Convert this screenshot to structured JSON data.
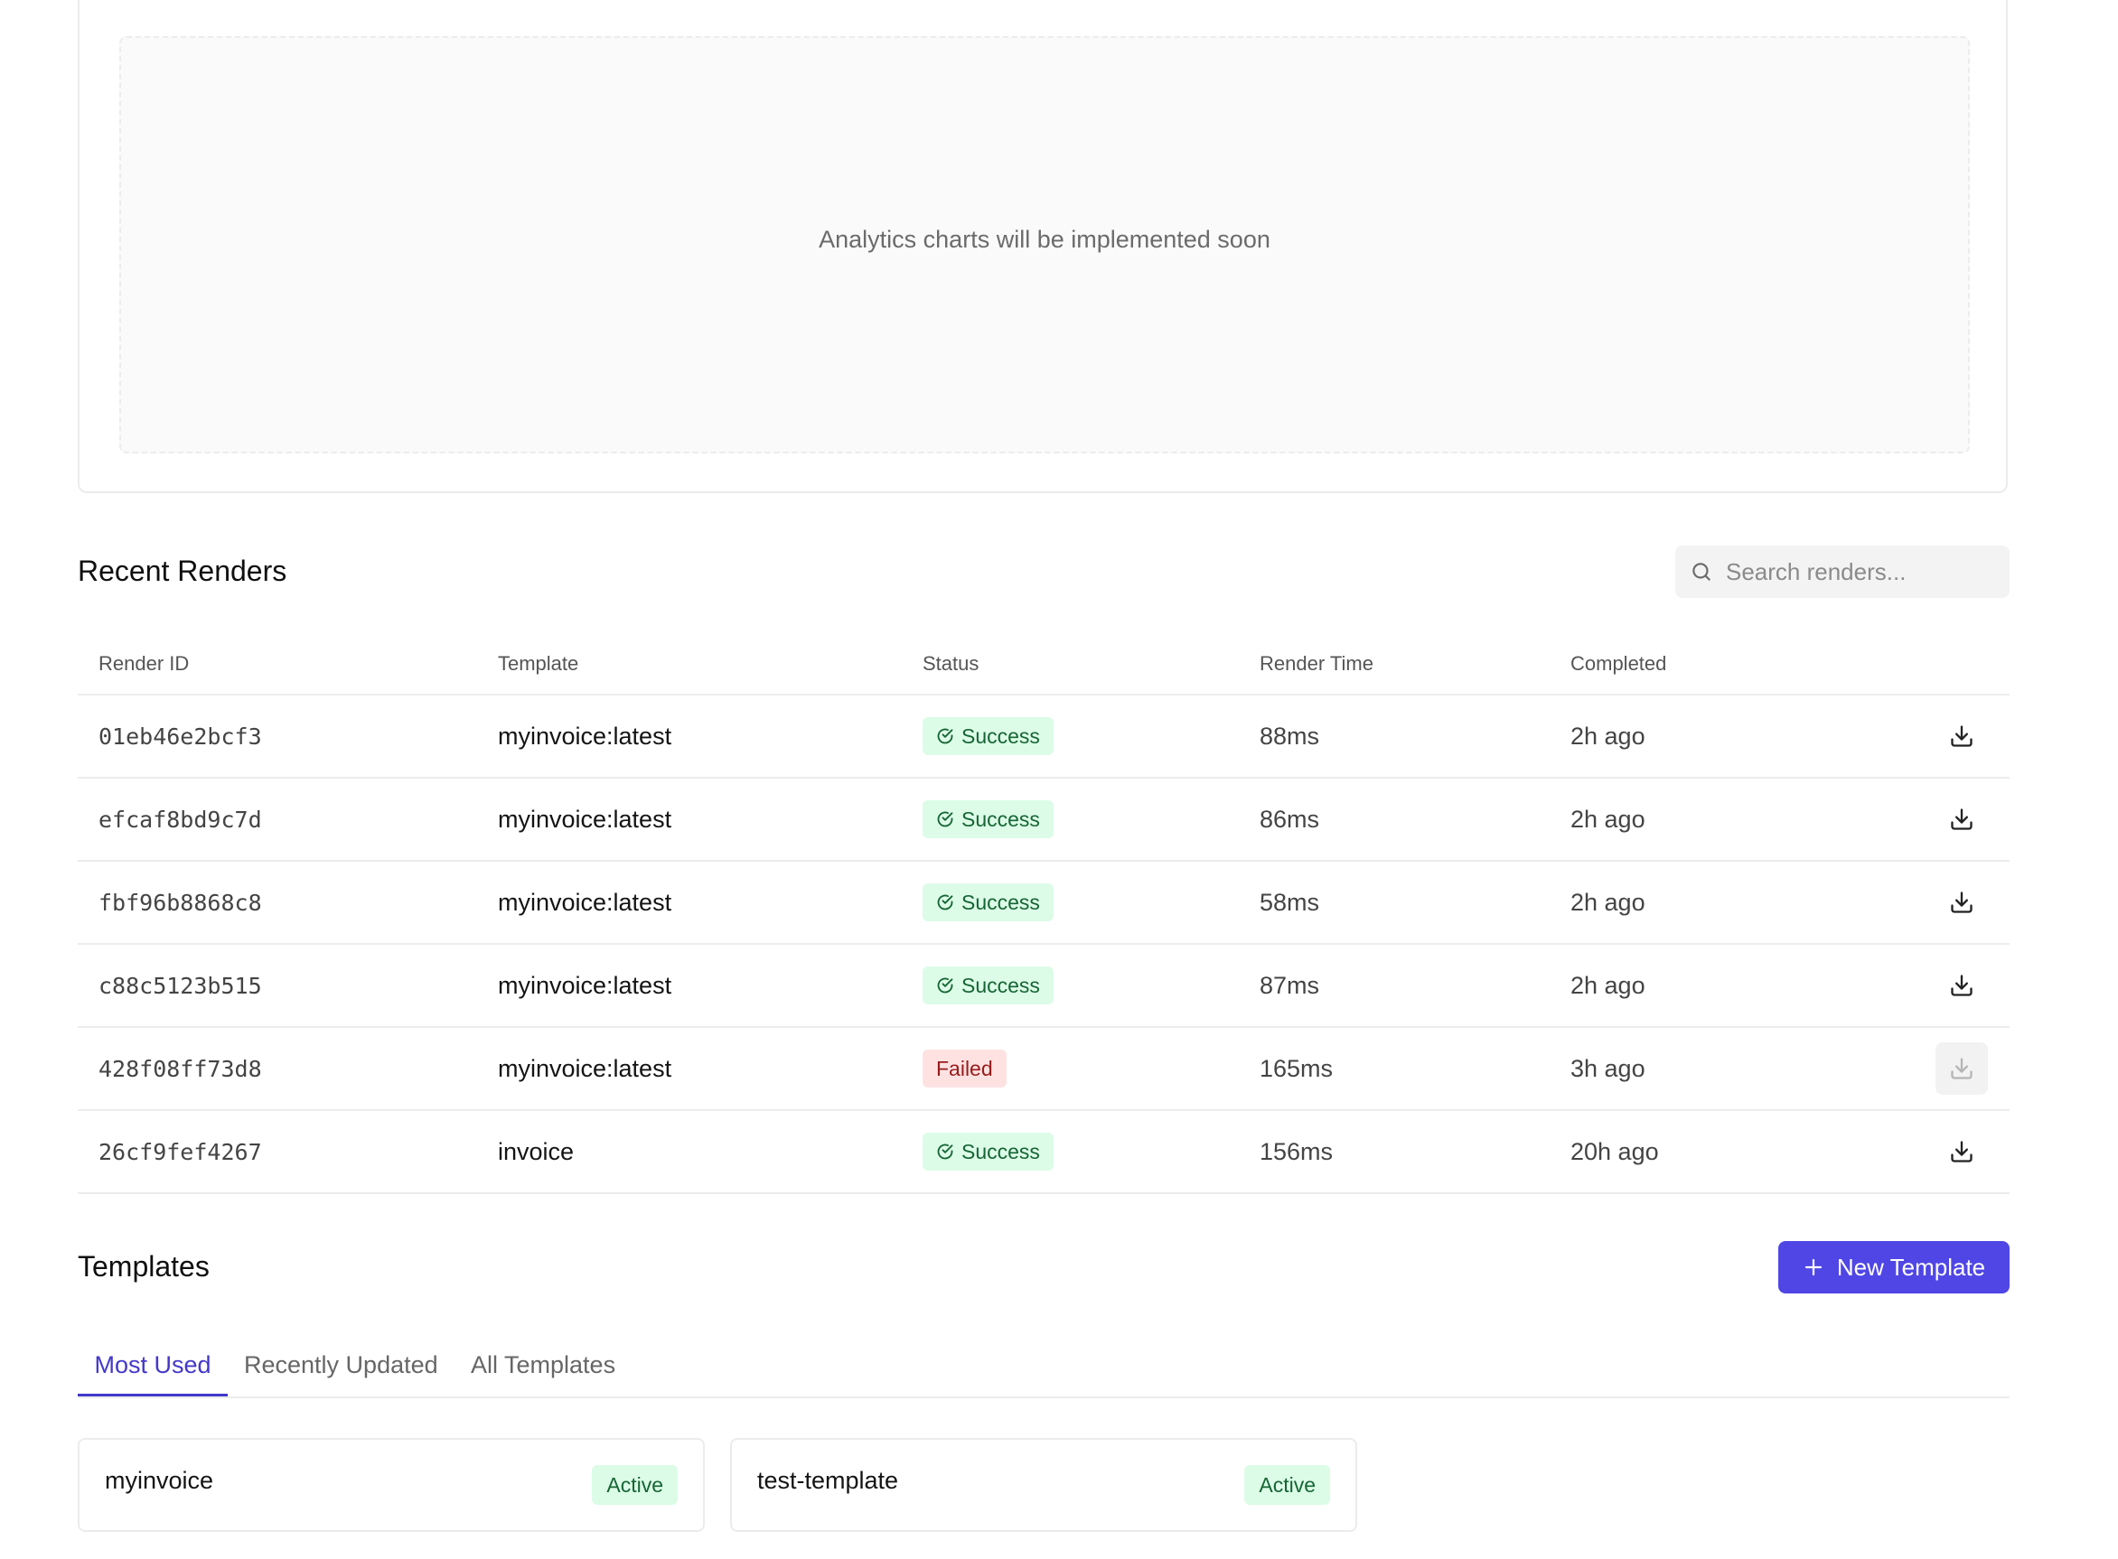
{
  "analytics": {
    "placeholder_text": "Analytics charts will be implemented soon"
  },
  "recent_renders": {
    "title": "Recent Renders",
    "search_placeholder": "Search renders...",
    "columns": {
      "render_id": "Render ID",
      "template": "Template",
      "status": "Status",
      "render_time": "Render Time",
      "completed": "Completed"
    },
    "rows": [
      {
        "id": "01eb46e2bcf3",
        "template": "myinvoice:latest",
        "status": "Success",
        "render_time": "88ms",
        "completed": "2h ago",
        "download_enabled": true
      },
      {
        "id": "efcaf8bd9c7d",
        "template": "myinvoice:latest",
        "status": "Success",
        "render_time": "86ms",
        "completed": "2h ago",
        "download_enabled": true
      },
      {
        "id": "fbf96b8868c8",
        "template": "myinvoice:latest",
        "status": "Success",
        "render_time": "58ms",
        "completed": "2h ago",
        "download_enabled": true
      },
      {
        "id": "c88c5123b515",
        "template": "myinvoice:latest",
        "status": "Success",
        "render_time": "87ms",
        "completed": "2h ago",
        "download_enabled": true
      },
      {
        "id": "428f08ff73d8",
        "template": "myinvoice:latest",
        "status": "Failed",
        "render_time": "165ms",
        "completed": "3h ago",
        "download_enabled": false
      },
      {
        "id": "26cf9fef4267",
        "template": "invoice",
        "status": "Success",
        "render_time": "156ms",
        "completed": "20h ago",
        "download_enabled": true
      }
    ]
  },
  "templates": {
    "title": "Templates",
    "new_button_label": "New Template",
    "tabs": [
      {
        "label": "Most Used",
        "active": true
      },
      {
        "label": "Recently Updated",
        "active": false
      },
      {
        "label": "All Templates",
        "active": false
      }
    ],
    "cards": [
      {
        "name": "myinvoice",
        "status": "Active"
      },
      {
        "name": "test-template",
        "status": "Active"
      }
    ]
  },
  "colors": {
    "accent": "#4f46e5",
    "success_bg": "#dcfce7",
    "success_fg": "#166534",
    "failed_bg": "#fee2e2",
    "failed_fg": "#991b1b"
  },
  "icons": {
    "search": "search-icon",
    "success": "check-circle-icon",
    "download": "download-icon",
    "plus": "plus-icon"
  }
}
